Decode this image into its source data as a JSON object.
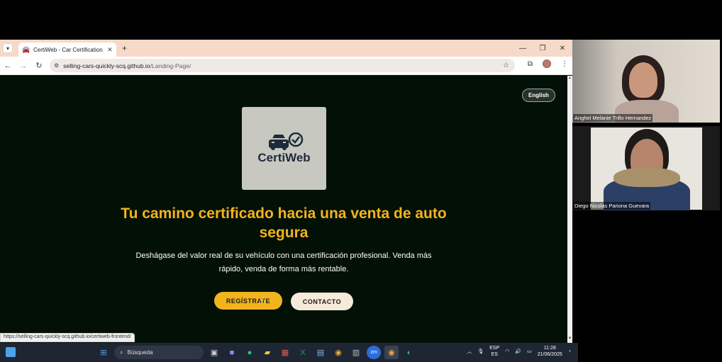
{
  "browser": {
    "tab_title": "CertiWeb - Car Certification",
    "tab_close": "✕",
    "new_tab": "+",
    "url_host": "selling-cars-quickly-scq.github.io",
    "url_path": "/Landing-Page/",
    "status_url": "https://selling-cars-quickly-scq.github.io/certiweb-frontend/",
    "window_minimize": "—",
    "window_restore": "❐",
    "window_close": "✕"
  },
  "page": {
    "lang_button": "English",
    "logo_text": "CertiWeb",
    "hero_title": "Tu camino certificado hacia una venta de auto segura",
    "hero_subtitle": "Deshágase del valor real de su vehículo con una certificación profesional. Venda más rápido, venda de forma más rentable.",
    "register_button": "REGÍSTRATE",
    "contact_button": "CONTACTO",
    "colors": {
      "accent": "#f2b41d",
      "background": "#031006",
      "contact_bg": "#f6ead9"
    }
  },
  "participants": [
    {
      "name": "Anghel Melanie Trillo Hernandez"
    },
    {
      "name": "Diego Nicolás Pariona Guevara"
    }
  ],
  "taskbar": {
    "search_label": "Búsqueda",
    "lang_top": "ESP",
    "lang_bottom": "ES",
    "time": "11:28",
    "date": "21/06/2025"
  }
}
